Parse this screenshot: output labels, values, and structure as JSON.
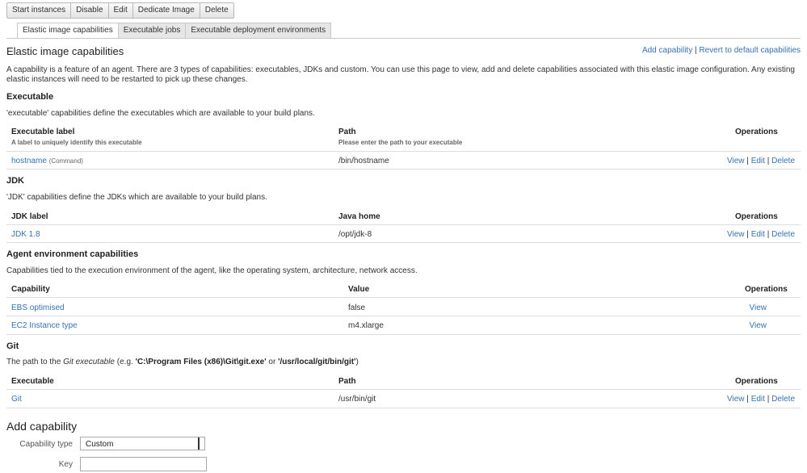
{
  "toolbar": {
    "buttons": [
      "Start instances",
      "Disable",
      "Edit",
      "Dedicate Image",
      "Delete"
    ]
  },
  "tabs": [
    "Elastic image capabilities",
    "Executable jobs",
    "Executable deployment environments"
  ],
  "page_title": "Elastic image capabilities",
  "top_actions": {
    "add": "Add capability",
    "sep": "|",
    "revert": "Revert to default capabilities"
  },
  "intro": "A capability is a feature of an agent. There are 3 types of capabilities: executables, JDKs and custom. You can use this page to view, add and delete capabilities associated with this elastic image configuration. Any existing elastic instances will need to be restarted to pick up these changes.",
  "ops": {
    "view": "View",
    "edit": "Edit",
    "delete": "Delete",
    "sep": "|"
  },
  "executable": {
    "heading": "Executable",
    "desc": "'executable' capabilities define the executables which are available to your build plans.",
    "col_label": "Executable label",
    "col_label_sub": "A label to uniquely identify this executable",
    "col_path": "Path",
    "col_path_sub": "Please enter the path to your executable",
    "col_ops": "Operations",
    "row": {
      "label": "hostname",
      "type": "(Command)",
      "path": "/bin/hostname"
    }
  },
  "jdk": {
    "heading": "JDK",
    "desc": "'JDK' capabilities define the JDKs which are available to your build plans.",
    "col_label": "JDK label",
    "col_home": "Java home",
    "col_ops": "Operations",
    "row": {
      "label": "JDK 1.8",
      "home": "/opt/jdk-8"
    }
  },
  "agent_env": {
    "heading": "Agent environment capabilities",
    "desc": "Capabilities tied to the execution environment of the agent, like the operating system, architecture, network access.",
    "col_cap": "Capability",
    "col_value": "Value",
    "col_ops": "Operations",
    "rows": [
      {
        "cap": "EBS optimised",
        "value": "false"
      },
      {
        "cap": "EC2 Instance type",
        "value": "m4.xlarge"
      }
    ]
  },
  "git": {
    "heading": "Git",
    "desc_pre": "The path to the ",
    "desc_em": "Git executable",
    "desc_mid": " (e.g. ",
    "desc_win": "'C:\\Program Files (x86)\\Git\\git.exe'",
    "desc_or": " or ",
    "desc_nix": "'/usr/local/git/bin/git'",
    "desc_end": ")",
    "col_exe": "Executable",
    "col_path": "Path",
    "col_ops": "Operations",
    "row": {
      "exe": "Git",
      "path": "/usr/bin/git"
    }
  },
  "add_form": {
    "title": "Add capability",
    "type_label": "Capability type",
    "type_value": "Custom",
    "key_label": "Key"
  }
}
